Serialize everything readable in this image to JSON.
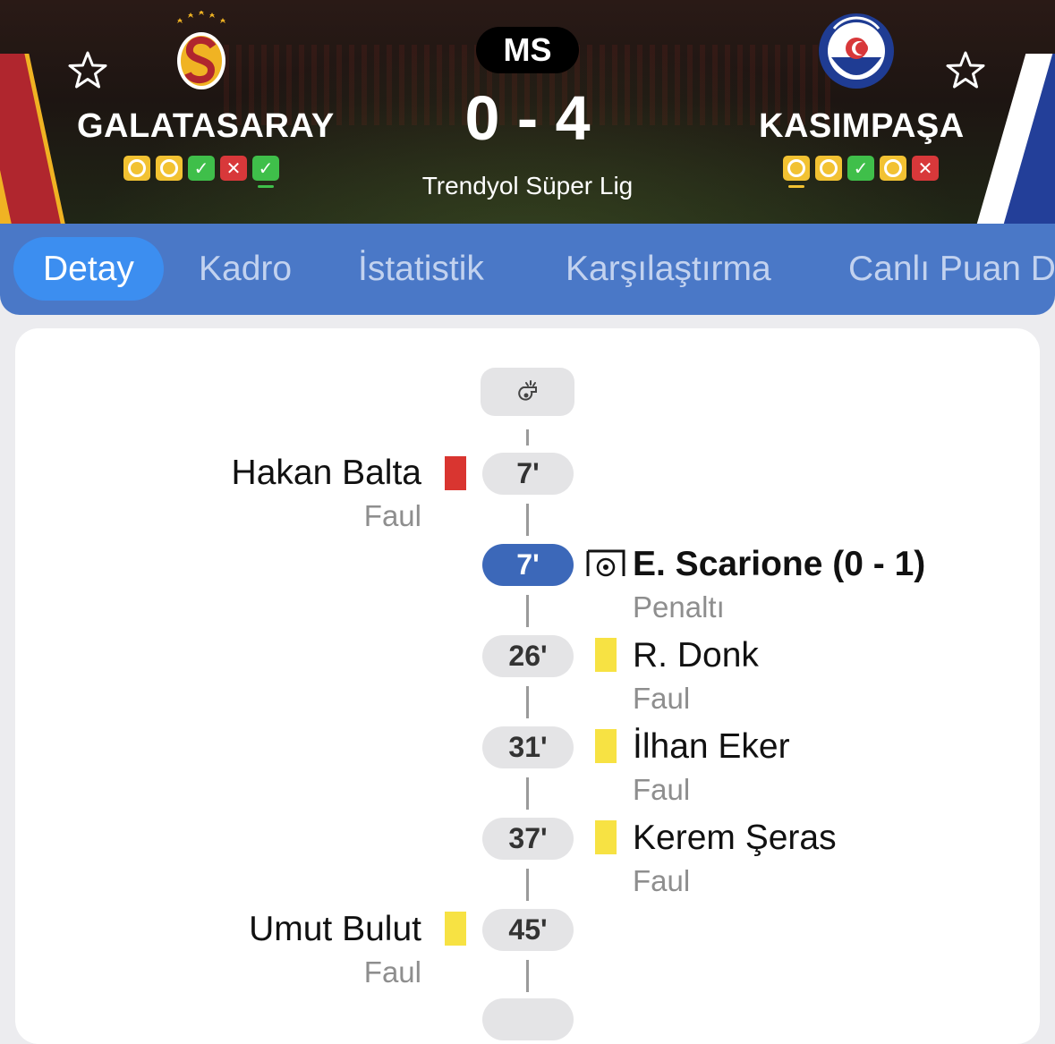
{
  "match": {
    "status": "MS",
    "score": "0 - 4",
    "league": "Trendyol Süper Lig",
    "home": {
      "name": "GALATASARAY",
      "form": [
        {
          "result": "draw",
          "current": false
        },
        {
          "result": "draw",
          "current": false
        },
        {
          "result": "win",
          "current": false
        },
        {
          "result": "loss",
          "current": false
        },
        {
          "result": "win",
          "current": true
        }
      ],
      "colors": {
        "primary": "#f0b323",
        "secondary": "#b0262e"
      }
    },
    "away": {
      "name": "KASIMPAŞA",
      "form": [
        {
          "result": "draw",
          "current": true
        },
        {
          "result": "draw",
          "current": false
        },
        {
          "result": "win",
          "current": false
        },
        {
          "result": "draw",
          "current": false
        },
        {
          "result": "loss",
          "current": false
        }
      ],
      "colors": {
        "primary": "#233f99",
        "secondary": "#ffffff"
      }
    }
  },
  "tabs": [
    {
      "label": "Detay",
      "active": true
    },
    {
      "label": "Kadro",
      "active": false
    },
    {
      "label": "İstatistik",
      "active": false
    },
    {
      "label": "Karşılaştırma",
      "active": false
    },
    {
      "label": "Canlı Puan D",
      "active": false
    }
  ],
  "events": [
    {
      "side": "home",
      "type": "red-card",
      "minute": "7'",
      "player": "Hakan Balta",
      "detail": "Faul"
    },
    {
      "side": "away",
      "type": "goal",
      "minute": "7'",
      "player": "E. Scarione (0 - 1)",
      "detail": "Penaltı"
    },
    {
      "side": "away",
      "type": "yellow-card",
      "minute": "26'",
      "player": "R. Donk",
      "detail": "Faul"
    },
    {
      "side": "away",
      "type": "yellow-card",
      "minute": "31'",
      "player": "İlhan Eker",
      "detail": "Faul"
    },
    {
      "side": "away",
      "type": "yellow-card",
      "minute": "37'",
      "player": "Kerem Şeras",
      "detail": "Faul"
    },
    {
      "side": "home",
      "type": "yellow-card",
      "minute": "45'",
      "player": "Umut Bulut",
      "detail": "Faul"
    }
  ],
  "icons": {
    "favorite": "star-outline-icon",
    "kickoff": "whistle-icon",
    "goal": "goal-net-icon",
    "red_card": "red-card-icon",
    "yellow_card": "yellow-card-icon"
  },
  "colors": {
    "tab_bar": "#4a78c7",
    "tab_active": "#3c8ef0",
    "goal_minute": "#3c68b9",
    "red_card": "#d93530",
    "yellow_card": "#f7e243",
    "form_win": "#3fbf4a",
    "form_draw": "#f2c232",
    "form_loss": "#d8383a"
  }
}
